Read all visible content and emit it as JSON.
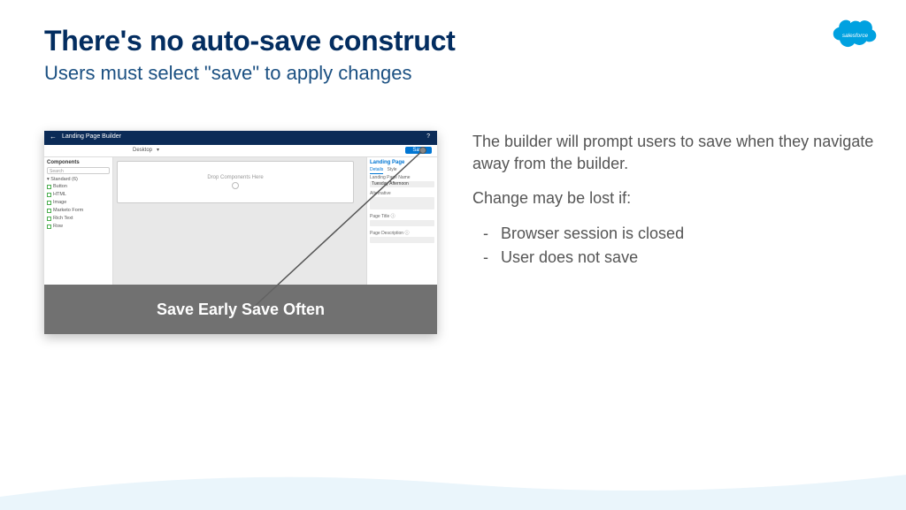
{
  "title": "There's no auto-save construct",
  "subtitle": "Users must select \"save\" to apply changes",
  "body": {
    "p1": "The builder will prompt users to save when they navigate away from the builder.",
    "p2": "Change may be lost if:",
    "bullets": [
      "Browser session is closed",
      "User does not save"
    ]
  },
  "callout": "Save Early Save Often",
  "builder": {
    "header_title": "Landing Page Builder",
    "help": "?",
    "device": "Desktop",
    "save": "Save",
    "left_panel_title": "Components",
    "search_placeholder": "Search",
    "group": "Standard (6)",
    "components": [
      "Button",
      "HTML",
      "Image",
      "Marketo Form",
      "Rich Text",
      "Row"
    ],
    "canvas_placeholder": "Drop Components Here",
    "right_panel_title": "Landing Page",
    "tab_details": "Details",
    "tab_style": "Style",
    "field_name_label": "Landing Page Name",
    "field_name_value": "Tuesday Afternoon",
    "field_alt_label": "Alternative",
    "field_pagetitle_label": "Page Title",
    "field_desc_label": "Page Description"
  },
  "logo_text": "salesforce"
}
